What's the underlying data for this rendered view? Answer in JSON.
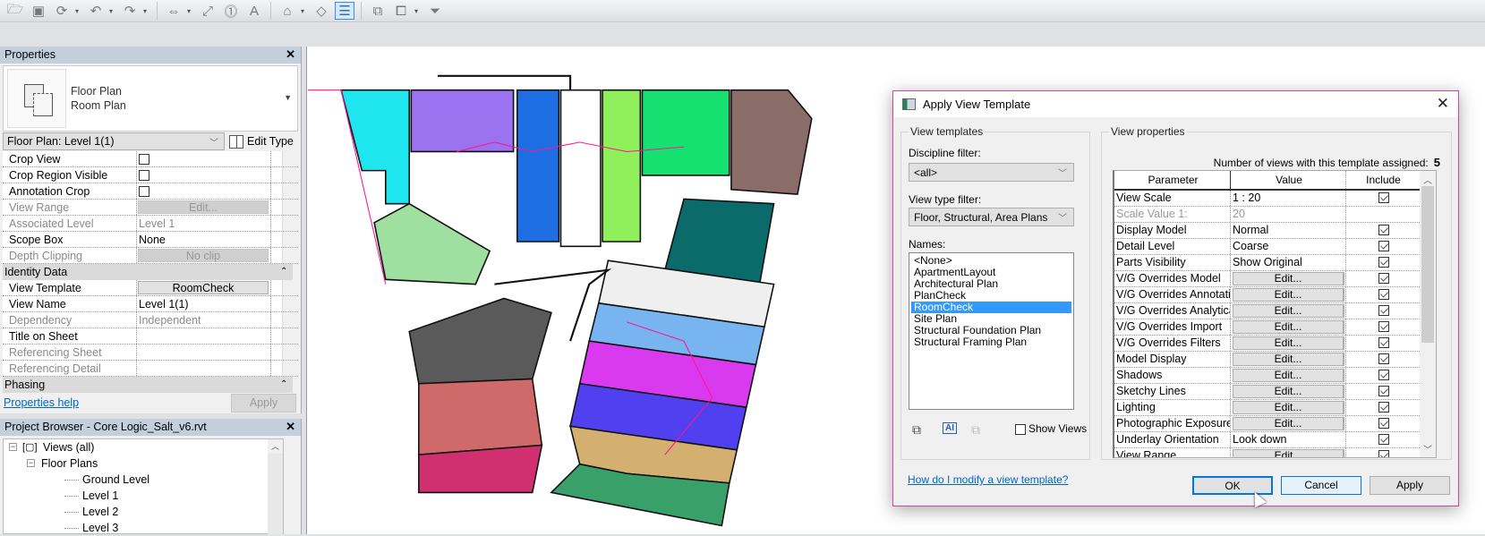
{
  "toolbar": {
    "icons": [
      {
        "name": "open-icon",
        "glyph": "🗁"
      },
      {
        "name": "save-icon",
        "glyph": "▣"
      },
      {
        "name": "sync-icon",
        "glyph": "⟳"
      },
      {
        "name": "dropdown-icon",
        "glyph": "▾"
      },
      {
        "name": "undo-icon",
        "glyph": "↶"
      },
      {
        "name": "dropdown-icon",
        "glyph": "▾"
      },
      {
        "name": "redo-icon",
        "glyph": "↷"
      },
      {
        "name": "dropdown-icon",
        "glyph": "▾"
      },
      {
        "name": "sep"
      },
      {
        "name": "measure-icon",
        "glyph": "⇔"
      },
      {
        "name": "dropdown-icon",
        "glyph": "▾"
      },
      {
        "name": "aligned-dimension-icon",
        "glyph": "⤢"
      },
      {
        "name": "tag-icon",
        "glyph": "⓵"
      },
      {
        "name": "text-icon",
        "glyph": "A"
      },
      {
        "name": "sep"
      },
      {
        "name": "3d-view-icon",
        "glyph": "⌂"
      },
      {
        "name": "dropdown-icon",
        "glyph": "▾"
      },
      {
        "name": "section-icon",
        "glyph": "◇"
      },
      {
        "name": "thin-lines-icon",
        "glyph": "☰",
        "active": true
      },
      {
        "name": "sep"
      },
      {
        "name": "close-hidden-windows-icon",
        "glyph": "⧉"
      },
      {
        "name": "switch-windows-icon",
        "glyph": "⧠"
      },
      {
        "name": "dropdown-icon",
        "glyph": "▾"
      },
      {
        "name": "customize-toolbar-icon",
        "glyph": "⏷"
      }
    ]
  },
  "properties": {
    "title": "Properties",
    "type_name": "Floor Plan",
    "type_sub": "Room Plan",
    "instance": "Floor Plan: Level 1(1)",
    "edit_type": "Edit Type",
    "rows": [
      {
        "label": "Crop View",
        "kind": "check"
      },
      {
        "label": "Crop Region Visible",
        "kind": "check"
      },
      {
        "label": "Annotation Crop",
        "kind": "check"
      },
      {
        "label": "View Range",
        "kind": "button-disabled",
        "value": "Edit...",
        "disabled": true
      },
      {
        "label": "Associated Level",
        "kind": "text",
        "value": "Level 1",
        "disabled": true
      },
      {
        "label": "Scope Box",
        "kind": "text",
        "value": "None"
      },
      {
        "label": "Depth Clipping",
        "kind": "button-disabled",
        "value": "No clip",
        "disabled": true
      },
      {
        "label": "Identity Data",
        "kind": "section"
      },
      {
        "label": "View Template",
        "kind": "button",
        "value": "RoomCheck"
      },
      {
        "label": "View Name",
        "kind": "text",
        "value": "Level 1(1)"
      },
      {
        "label": "Dependency",
        "kind": "text",
        "value": "Independent",
        "disabled": true
      },
      {
        "label": "Title on Sheet",
        "kind": "text",
        "value": ""
      },
      {
        "label": "Referencing Sheet",
        "kind": "text",
        "value": "",
        "disabled": true
      },
      {
        "label": "Referencing Detail",
        "kind": "text",
        "value": "",
        "disabled": true
      },
      {
        "label": "Phasing",
        "kind": "section"
      }
    ],
    "section_toggle": "⌃",
    "help": "Properties help",
    "apply": "Apply"
  },
  "browser": {
    "title": "Project Browser - Core Logic_Salt_v6.rvt",
    "tree": [
      {
        "label": "Views (all)",
        "level": 0,
        "expander": "−"
      },
      {
        "label": "Floor Plans",
        "level": 1,
        "expander": "−"
      },
      {
        "label": "Ground Level",
        "level": 2
      },
      {
        "label": "Level 1",
        "level": 2
      },
      {
        "label": "Level 2",
        "level": 2
      },
      {
        "label": "Level 3",
        "level": 2
      }
    ]
  },
  "dialog": {
    "title": "Apply View Template",
    "close": "✕",
    "templates_group": "View templates",
    "discipline_label": "Discipline filter:",
    "discipline_value": "<all>",
    "viewtype_label": "View type filter:",
    "viewtype_value": "Floor, Structural, Area Plans",
    "names_label": "Names:",
    "names": [
      "<None>",
      "ApartmentLayout",
      "Architectural Plan",
      "PlanCheck",
      "RoomCheck",
      "Site Plan",
      "Structural Foundation Plan",
      "Structural Framing Plan"
    ],
    "selected_name": "RoomCheck",
    "show_views": "Show Views",
    "help_link": "How do I modify a view template?",
    "props_group": "View properties",
    "count_label": "Number of views with this template assigned:",
    "count": "5",
    "columns": [
      "Parameter",
      "Value",
      "Include"
    ],
    "params": [
      {
        "name": "View Scale",
        "value": "1 : 20",
        "kind": "text",
        "include": true
      },
      {
        "name": "Scale Value    1:",
        "value": "20",
        "kind": "text",
        "include": null,
        "disabled": true
      },
      {
        "name": "Display Model",
        "value": "Normal",
        "kind": "text",
        "include": true
      },
      {
        "name": "Detail Level",
        "value": "Coarse",
        "kind": "text",
        "include": true
      },
      {
        "name": "Parts Visibility",
        "value": "Show Original",
        "kind": "text",
        "include": true
      },
      {
        "name": "V/G Overrides Model",
        "value": "Edit...",
        "kind": "button",
        "include": true
      },
      {
        "name": "V/G Overrides Annotati",
        "value": "Edit...",
        "kind": "button",
        "include": true
      },
      {
        "name": "V/G Overrides Analytica",
        "value": "Edit...",
        "kind": "button",
        "include": true
      },
      {
        "name": "V/G Overrides Import",
        "value": "Edit...",
        "kind": "button",
        "include": true
      },
      {
        "name": "V/G Overrides Filters",
        "value": "Edit...",
        "kind": "button",
        "include": true
      },
      {
        "name": "Model Display",
        "value": "Edit...",
        "kind": "button",
        "include": true
      },
      {
        "name": "Shadows",
        "value": "Edit...",
        "kind": "button",
        "include": true
      },
      {
        "name": "Sketchy Lines",
        "value": "Edit...",
        "kind": "button",
        "include": true
      },
      {
        "name": "Lighting",
        "value": "Edit...",
        "kind": "button",
        "include": true
      },
      {
        "name": "Photographic Exposure",
        "value": "Edit...",
        "kind": "button",
        "include": true
      },
      {
        "name": "Underlay Orientation",
        "value": "Look down",
        "kind": "text",
        "include": true
      },
      {
        "name": "View Range",
        "value": "Edit...",
        "kind": "button",
        "include": true
      }
    ],
    "ok": "OK",
    "cancel": "Cancel",
    "apply": "Apply"
  },
  "colors": {
    "dialog_border": "#e0409a",
    "selection": "#3399ff",
    "link": "#0066cc",
    "room_boundary": "#ff1493"
  }
}
